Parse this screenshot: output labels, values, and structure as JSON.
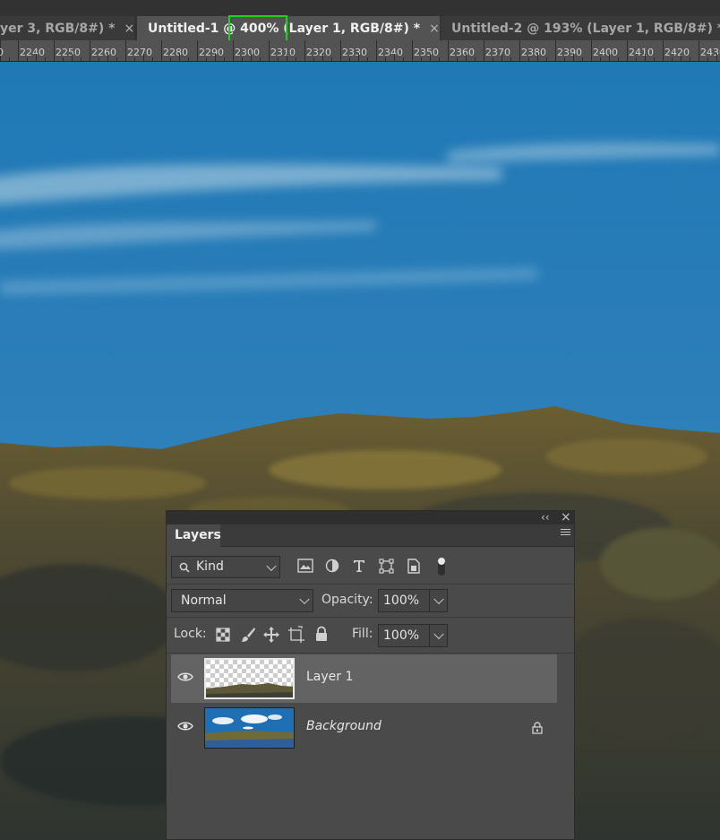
{
  "tabs": [
    {
      "label": "yer 3, RGB/8#) *",
      "close": "×"
    },
    {
      "label": "Untitled-1 @ 400% (Layer 1, RGB/8#) *",
      "close": "×"
    },
    {
      "label": "Untitled-2 @ 193% (Layer 1, RGB/8#) *",
      "close": "×"
    }
  ],
  "ruler": {
    "labels": [
      "0",
      "2240",
      "2250",
      "2260",
      "2270",
      "2280",
      "2290",
      "2300",
      "2310",
      "2320",
      "2330",
      "2340",
      "2350",
      "2360",
      "2370",
      "2380",
      "2390",
      "2400",
      "2410",
      "2420",
      "2430"
    ]
  },
  "layers_panel": {
    "collapse": "‹‹",
    "close": "×",
    "title": "Layers",
    "filter_kind": "Kind",
    "blend_mode": "Normal",
    "opacity_label": "Opacity:",
    "opacity_value": "100%",
    "lock_label": "Lock:",
    "fill_label": "Fill:",
    "fill_value": "100%",
    "layers": [
      {
        "name": "Layer 1",
        "selected": true
      },
      {
        "name": "Background",
        "locked": true
      }
    ]
  },
  "colors": {
    "highlight": "#1ed21e",
    "sky": "#2a7db7",
    "panel": "#4a4a4a"
  }
}
